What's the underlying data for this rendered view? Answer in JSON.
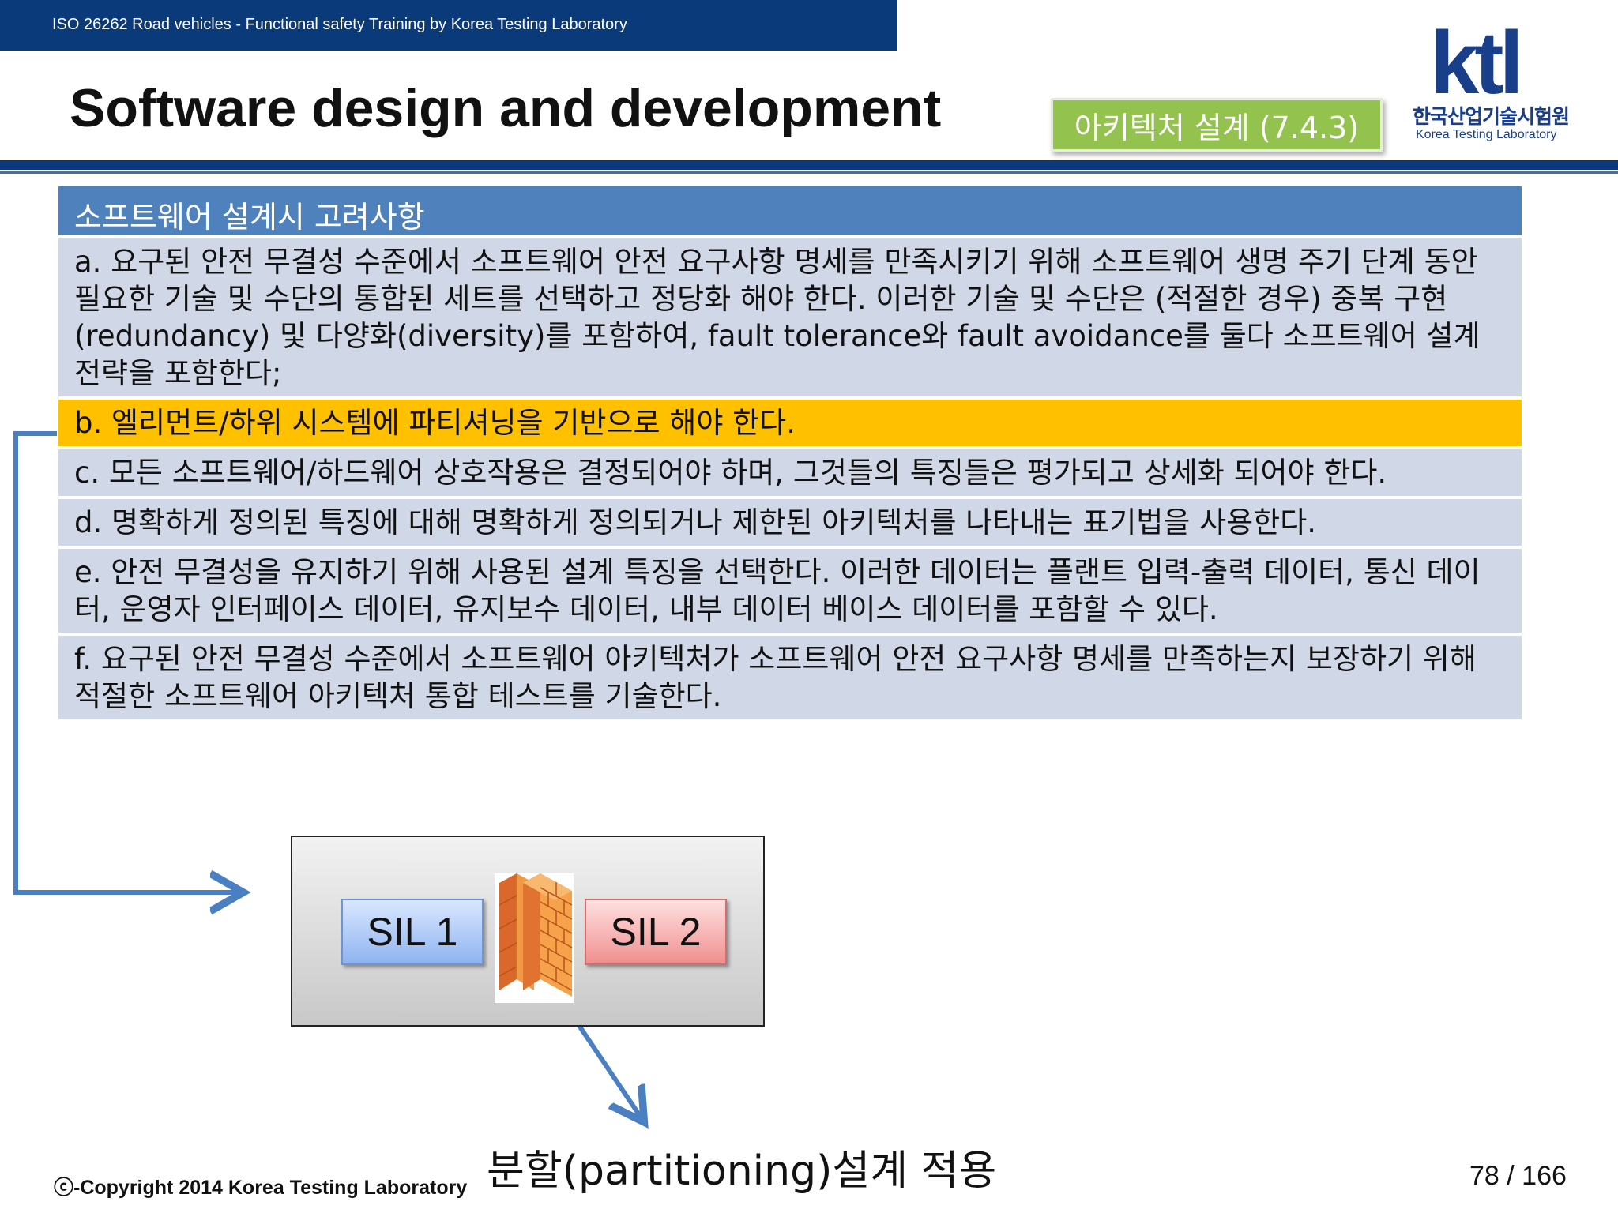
{
  "header": {
    "course": "ISO 26262 Road vehicles - Functional safety Training by Korea Testing Laboratory"
  },
  "title": "Software design and development",
  "section_tag": "아키텍처 설계 (7.4.3)",
  "logo": {
    "word": "ktl",
    "korean_name": "한국산업기술시험원",
    "english_name": "Korea Testing Laboratory"
  },
  "panel": {
    "heading": "소프트웨어 설계시 고려사항",
    "items": [
      "a. 요구된 안전 무결성 수준에서 소프트웨어 안전 요구사항 명세를 만족시키기 위해 소프트웨어 생명 주기 단계 동안 필요한 기술 및 수단의 통합된 세트를 선택하고 정당화 해야 한다. 이러한 기술 및 수단은 (적절한 경우) 중복 구현(redundancy) 및 다양화(diversity)를 포함하여, fault tolerance와 fault avoidance를 둘다 소프트웨어 설계 전략을 포함한다;",
      "b. 엘리먼트/하위 시스템에 파티셔닝을 기반으로 해야 한다.",
      "c. 모든 소프트웨어/하드웨어 상호작용은 결정되어야 하며, 그것들의 특징들은 평가되고 상세화 되어야 한다.",
      "d. 명확하게 정의된 특징에 대해 명확하게 정의되거나 제한된 아키텍처를 나타내는 표기법을 사용한다.",
      "e. 안전 무결성을 유지하기 위해 사용된 설계 특징을 선택한다. 이러한 데이터는 플랜트 입력-출력 데이터, 통신 데이터, 운영자 인터페이스 데이터, 유지보수 데이터, 내부 데이터 베이스 데이터를 포함할 수 있다.",
      "f. 요구된 안전 무결성 수준에서 소프트웨어 아키텍처가 소프트웨어 안전 요구사항 명세를 만족하는지 보장하기 위해 적절한 소프트웨어 아키텍처 통합 테스트를 기술한다."
    ]
  },
  "diagram": {
    "left_label": "SIL 1",
    "right_label": "SIL 2",
    "separator_icon": "firewall-icon",
    "caption": "분할(partitioning)설계 적용"
  },
  "footer": {
    "copyright": "ⓒ-Copyright 2014 Korea Testing Laboratory",
    "page_number": "78 / 166"
  },
  "colors": {
    "navy": "#0b3a7a",
    "accent_green": "#93c24f",
    "panel_head": "#4f81bd",
    "panel_row": "#d0d8e8",
    "highlight": "#ffc000",
    "arrow": "#4a7fc1"
  }
}
